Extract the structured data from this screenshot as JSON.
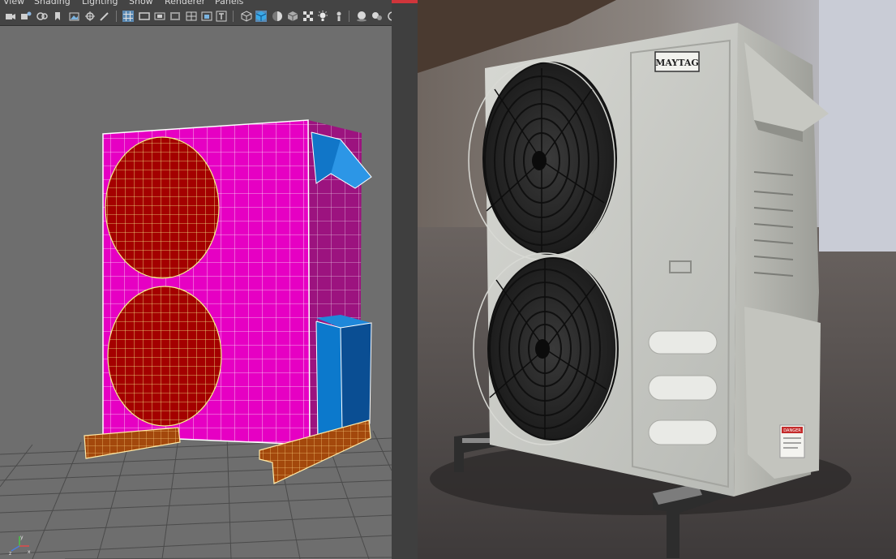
{
  "menu": {
    "items": [
      "View",
      "Shading",
      "Lighting",
      "Show",
      "Renderer",
      "Panels"
    ]
  },
  "toolbar": {
    "icons": [
      "camera-icon",
      "camera-attributes-icon",
      "bookmark-icon",
      "image-plane-icon",
      "grid-icon",
      "film-gate-icon",
      "resolution-gate-icon",
      "gate-mask-icon",
      "field-chart-icon",
      "safe-action-icon",
      "safe-title-icon",
      "wireframe-icon",
      "smooth-shade-icon",
      "default-material-icon",
      "textured-icon",
      "use-all-lights-icon",
      "shadows-icon",
      "ambient-occlusion-icon",
      "isolate-select-icon",
      "xray-icon"
    ]
  },
  "photo": {
    "brand_label": "MAYTAG",
    "warning_label": "DANGER"
  },
  "axis": {
    "x": "x",
    "y": "y",
    "z": "z"
  },
  "colors": {
    "viewport_bg": "#6e6e6e",
    "panel_bg": "#444444",
    "mesh_magenta": "#e600c3",
    "mesh_side": "#9c137f",
    "fan_red": "#a40000",
    "ui_blue": "#0e79c9",
    "accent_red": "#d0353b"
  }
}
